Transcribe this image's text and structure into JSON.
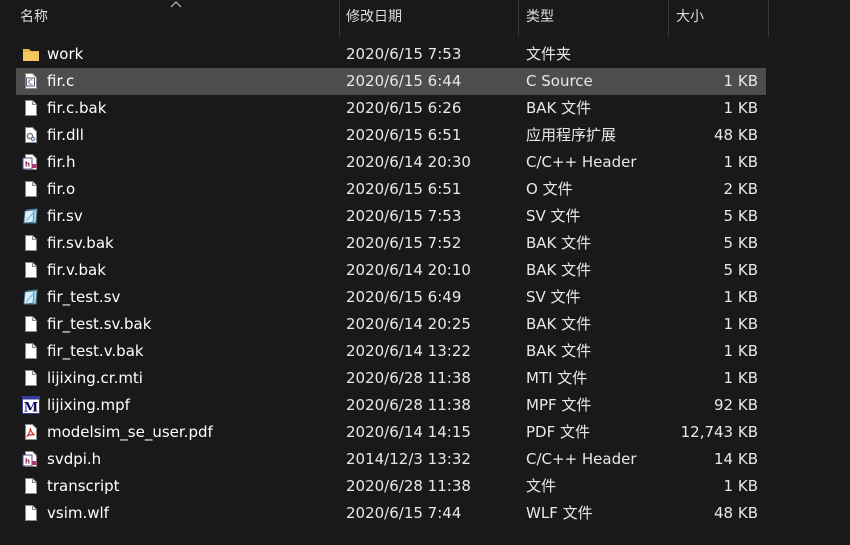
{
  "columns": {
    "name": "名称",
    "date": "修改日期",
    "type": "类型",
    "size": "大小"
  },
  "selected_index": 1,
  "files": [
    {
      "name": "work",
      "date": "2020/6/15 7:53",
      "type": "文件夹",
      "size": "",
      "icon": "folder-icon"
    },
    {
      "name": "fir.c",
      "date": "2020/6/15 6:44",
      "type": "C Source",
      "size": "1 KB",
      "icon": "c-source-file-icon"
    },
    {
      "name": "fir.c.bak",
      "date": "2020/6/15 6:26",
      "type": "BAK 文件",
      "size": "1 KB",
      "icon": "blank-file-icon"
    },
    {
      "name": "fir.dll",
      "date": "2020/6/15 6:51",
      "type": "应用程序扩展",
      "size": "48 KB",
      "icon": "dll-file-icon"
    },
    {
      "name": "fir.h",
      "date": "2020/6/14 20:30",
      "type": "C/C++ Header",
      "size": "1 KB",
      "icon": "header-file-icon"
    },
    {
      "name": "fir.o",
      "date": "2020/6/15 6:51",
      "type": "O 文件",
      "size": "2 KB",
      "icon": "blank-file-icon"
    },
    {
      "name": "fir.sv",
      "date": "2020/6/15 7:53",
      "type": "SV 文件",
      "size": "5 KB",
      "icon": "sv-file-icon"
    },
    {
      "name": "fir.sv.bak",
      "date": "2020/6/15 7:52",
      "type": "BAK 文件",
      "size": "5 KB",
      "icon": "blank-file-icon"
    },
    {
      "name": "fir.v.bak",
      "date": "2020/6/14 20:10",
      "type": "BAK 文件",
      "size": "5 KB",
      "icon": "blank-file-icon"
    },
    {
      "name": "fir_test.sv",
      "date": "2020/6/15 6:49",
      "type": "SV 文件",
      "size": "1 KB",
      "icon": "sv-file-icon"
    },
    {
      "name": "fir_test.sv.bak",
      "date": "2020/6/14 20:25",
      "type": "BAK 文件",
      "size": "1 KB",
      "icon": "blank-file-icon"
    },
    {
      "name": "fir_test.v.bak",
      "date": "2020/6/14 13:22",
      "type": "BAK 文件",
      "size": "1 KB",
      "icon": "blank-file-icon"
    },
    {
      "name": "lijixing.cr.mti",
      "date": "2020/6/28 11:38",
      "type": "MTI 文件",
      "size": "1 KB",
      "icon": "blank-file-icon"
    },
    {
      "name": "lijixing.mpf",
      "date": "2020/6/28 11:38",
      "type": "MPF 文件",
      "size": "92 KB",
      "icon": "modelsim-project-icon"
    },
    {
      "name": "modelsim_se_user.pdf",
      "date": "2020/6/14 14:15",
      "type": "PDF 文件",
      "size": "12,743 KB",
      "icon": "pdf-file-icon"
    },
    {
      "name": "svdpi.h",
      "date": "2014/12/3 13:32",
      "type": "C/C++ Header",
      "size": "14 KB",
      "icon": "header-file-icon"
    },
    {
      "name": "transcript",
      "date": "2020/6/28 11:38",
      "type": "文件",
      "size": "1 KB",
      "icon": "blank-file-icon"
    },
    {
      "name": "vsim.wlf",
      "date": "2020/6/15 7:44",
      "type": "WLF 文件",
      "size": "48 KB",
      "icon": "blank-file-icon"
    }
  ],
  "colors": {
    "background": "#191919",
    "selected_row": "#4d4d4d",
    "folder": "#e8b84a",
    "pdf_red": "#d32f2f"
  }
}
